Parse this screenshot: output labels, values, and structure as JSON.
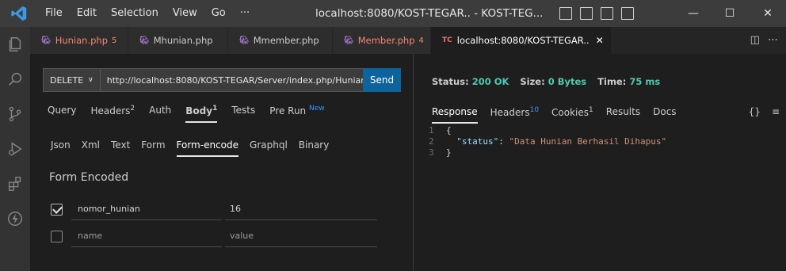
{
  "menu": [
    "File",
    "Edit",
    "Selection",
    "View",
    "Go",
    "···"
  ],
  "window_title": "localhost:8080/KOST-TEGAR.. - KOST-TEG...",
  "window_controls": {
    "minimize": "—",
    "maximize": "☐",
    "close": "✕"
  },
  "tabs": [
    {
      "label": "Hunian.php",
      "badge": "5",
      "label_color": "#f48771"
    },
    {
      "label": "Mhunian.php",
      "badge": "",
      "label_color": "#cccccc"
    },
    {
      "label": "Mmember.php",
      "badge": "",
      "label_color": "#cccccc"
    },
    {
      "label": "Member.php",
      "badge": "4",
      "label_color": "#f48771"
    },
    {
      "label": "localhost:8080/KOST-TEGAR..",
      "badge": "",
      "label_color": "#ffffff",
      "prefix": "TC",
      "active": true
    }
  ],
  "request": {
    "method": "DELETE",
    "url": "http://localhost:8080/KOST-TEGAR/Server/index.php/Hunian",
    "send_label": "Send",
    "tabs": [
      {
        "label": "Query",
        "sup": ""
      },
      {
        "label": "Headers",
        "sup": "2"
      },
      {
        "label": "Auth",
        "sup": ""
      },
      {
        "label": "Body",
        "sup": "1",
        "selected": true
      },
      {
        "label": "Tests",
        "sup": ""
      },
      {
        "label": "Pre Run",
        "sup": "New"
      }
    ],
    "body_tabs": [
      "Json",
      "Xml",
      "Text",
      "Form",
      "Form-encode",
      "Graphql",
      "Binary"
    ],
    "body_selected": "Form-encode",
    "form_title": "Form Encoded",
    "form_rows": [
      {
        "checked": true,
        "key": "nomor_hunian",
        "value": "16"
      },
      {
        "checked": false,
        "key": "name",
        "value": "value",
        "placeholder": true
      }
    ]
  },
  "response": {
    "status_label": "Status:",
    "status_value": "200 OK",
    "size_label": "Size:",
    "size_value": "0 Bytes",
    "time_label": "Time:",
    "time_value": "75 ms",
    "tabs": [
      {
        "label": "Response",
        "sup": "",
        "selected": true
      },
      {
        "label": "Headers",
        "sup": "10"
      },
      {
        "label": "Cookies",
        "sup": "1"
      },
      {
        "label": "Results",
        "sup": ""
      },
      {
        "label": "Docs",
        "sup": ""
      }
    ],
    "icons": [
      "{}",
      "≡"
    ],
    "lines": [
      {
        "n": "1",
        "text": "{"
      },
      {
        "n": "2",
        "key": "\"status\"",
        "value": "\"Data Hunian Berhasil Dihapus\""
      },
      {
        "n": "3",
        "text": "}"
      }
    ]
  },
  "colors": {
    "accent": "#0e639c",
    "status_ok": "#4ec9b0",
    "modified_tab": "#f48771"
  }
}
